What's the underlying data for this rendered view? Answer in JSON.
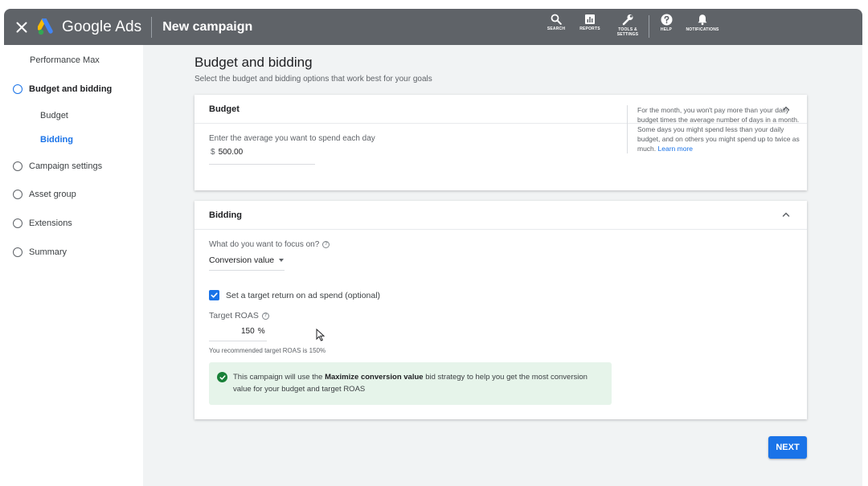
{
  "topbar": {
    "brand": "Google Ads",
    "page_title": "New campaign",
    "tools": [
      {
        "label": "SEARCH",
        "icon": "search-icon"
      },
      {
        "label": "REPORTS",
        "icon": "reports-icon"
      },
      {
        "label": "TOOLS & SETTINGS",
        "icon": "wrench-icon"
      },
      {
        "label": "HELP",
        "icon": "help-icon"
      },
      {
        "label": "NOTIFICATIONS",
        "icon": "bell-icon"
      }
    ]
  },
  "sidebar": {
    "items": [
      {
        "label": "Performance Max"
      },
      {
        "label": "Budget and bidding"
      },
      {
        "label": "Budget"
      },
      {
        "label": "Bidding"
      },
      {
        "label": "Campaign settings"
      },
      {
        "label": "Asset group"
      },
      {
        "label": "Extensions"
      },
      {
        "label": "Summary"
      }
    ]
  },
  "main": {
    "title": "Budget and bidding",
    "subtitle": "Select the budget and bidding options that work best for your goals"
  },
  "budget": {
    "header": "Budget",
    "field_label": "Enter the average you want to spend each day",
    "currency": "$",
    "value": "500.00",
    "note": "For the month, you won't pay more than your daily budget times the average number of days in a month. Some days you might spend less than your daily budget, and on others you might spend up to twice as much.",
    "learn_more": "Learn more"
  },
  "bidding": {
    "header": "Bidding",
    "focus_label": "What do you want to focus on?",
    "focus_value": "Conversion value",
    "checkbox_label": "Set a target return on ad spend (optional)",
    "checkbox_checked": true,
    "roas_label": "Target ROAS",
    "roas_value": "150",
    "roas_unit": "%",
    "roas_hint": "You recommended target ROAS is 150%",
    "info_pre": "This campaign will use the ",
    "info_bold": "Maximize conversion value",
    "info_post": " bid strategy to help you get the most conversion value for your budget and target ROAS"
  },
  "footer": {
    "next_label": "NEXT"
  },
  "colors": {
    "topbar": "#5f6368",
    "accent": "#1a73e8",
    "success": "#188038",
    "info_bg": "#e6f4ea",
    "background": "#f1f3f4"
  }
}
